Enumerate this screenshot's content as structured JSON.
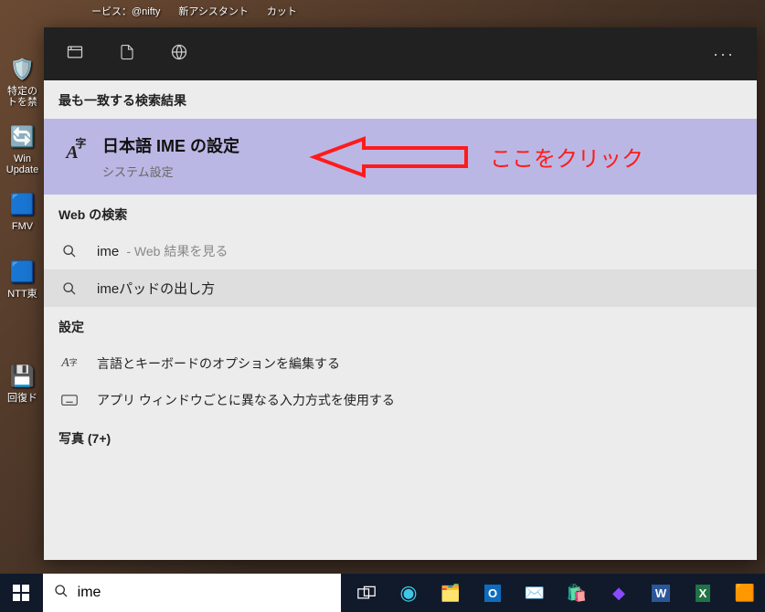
{
  "top_labels": {
    "l1": "ービス：@nifty",
    "l2": "新アシスタント",
    "l3": "カット"
  },
  "desktop": {
    "icon1": {
      "label": "特定の\nトを禁"
    },
    "icon2": {
      "label": "Win\nUpdate"
    },
    "icon3": {
      "label": "FMV"
    },
    "icon4": {
      "label": "NTT東"
    },
    "icon5": {
      "label": "回復ド"
    }
  },
  "panel": {
    "best_match_header": "最も一致する検索結果",
    "primary": {
      "icon_code": "A字",
      "title": "日本語 IME の設定",
      "subtitle": "システム設定"
    },
    "web_header": "Web の検索",
    "web1": {
      "text": "ime",
      "suffix": "- Web 結果を見る"
    },
    "web2": {
      "text": "imeパッドの出し方"
    },
    "settings_header": "設定",
    "settings1": "言語とキーボードのオプションを編集する",
    "settings2": "アプリ ウィンドウごとに異なる入力方式を使用する",
    "photos_header": "写真 (7+)"
  },
  "annotation": {
    "text": "ここをクリック",
    "color": "#ff1b1b"
  },
  "search": {
    "value": "ime"
  },
  "colors": {
    "primary_bg": "#bbb7e4",
    "panel_top": "#212121",
    "taskbar": "#101a2b"
  }
}
